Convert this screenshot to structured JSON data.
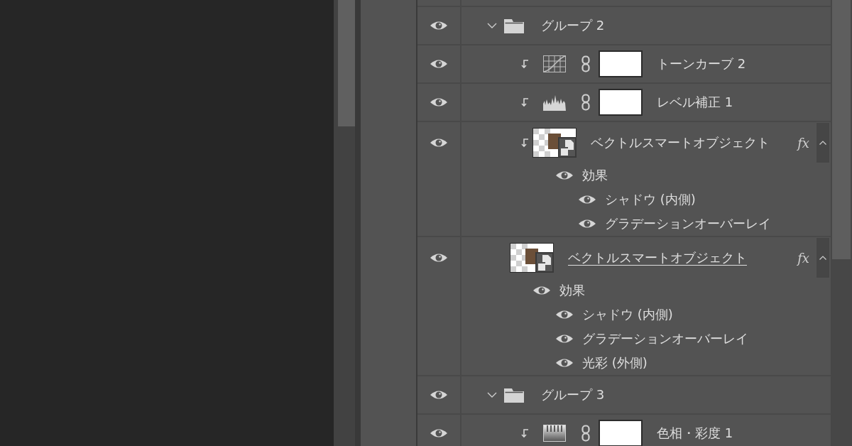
{
  "layers": [
    {
      "kind": "group",
      "name": "グループ 2",
      "visible": true,
      "expanded": true,
      "children": [
        {
          "kind": "curves",
          "name": "トーンカーブ 2",
          "visible": true,
          "clipped": true,
          "clip_base": false
        },
        {
          "kind": "levels",
          "name": "レベル補正 1",
          "visible": true,
          "clipped": true,
          "clip_base": false
        },
        {
          "kind": "smart-object",
          "name": "ベクトルスマートオブジェクト",
          "visible": true,
          "clipped": true,
          "clip_base": false,
          "fx": "fx",
          "expanded": true,
          "effects": {
            "label": "効果",
            "visible": true,
            "items": [
              {
                "name": "シャドウ (内側)",
                "visible": true
              },
              {
                "name": "グラデーションオーバーレイ",
                "visible": true
              }
            ]
          }
        },
        {
          "kind": "smart-object",
          "name": "ベクトルスマートオブジェクト",
          "visible": true,
          "clipped": false,
          "clip_base": true,
          "fx": "fx",
          "expanded": true,
          "effects": {
            "label": "効果",
            "visible": true,
            "items": [
              {
                "name": "シャドウ (内側)",
                "visible": true
              },
              {
                "name": "グラデーションオーバーレイ",
                "visible": true
              },
              {
                "name": "光彩 (外側)",
                "visible": true
              }
            ]
          }
        }
      ]
    },
    {
      "kind": "group",
      "name": "グループ 3",
      "visible": true,
      "expanded": true,
      "children": [
        {
          "kind": "hue-saturation",
          "name": "色相・彩度 1",
          "visible": true,
          "clipped": true,
          "clip_base": false
        }
      ]
    }
  ]
}
